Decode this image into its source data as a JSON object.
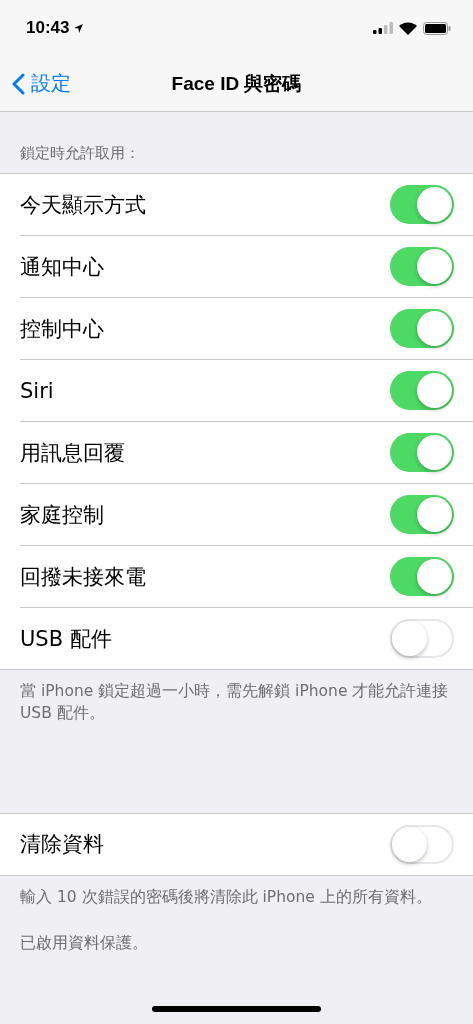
{
  "status_bar": {
    "time": "10:43"
  },
  "nav_bar": {
    "back": "設定",
    "title": "Face ID 與密碼"
  },
  "groups": [
    {
      "header": "鎖定時允許取用：",
      "rows": [
        {
          "label": "今天顯示方式",
          "on": true
        },
        {
          "label": "通知中心",
          "on": true
        },
        {
          "label": "控制中心",
          "on": true
        },
        {
          "label": "Siri",
          "on": true
        },
        {
          "label": "用訊息回覆",
          "on": true
        },
        {
          "label": "家庭控制",
          "on": true
        },
        {
          "label": "回撥未接來電",
          "on": true
        },
        {
          "label": "USB 配件",
          "on": false
        }
      ],
      "footers": [
        "當 iPhone 鎖定超過一小時，需先解鎖 iPhone 才能允許連接 USB 配件。"
      ]
    },
    {
      "rows": [
        {
          "label": "清除資料",
          "on": false
        }
      ],
      "footers": [
        "輸入 10 次錯誤的密碼後將清除此 iPhone 上的所有資料。",
        "已啟用資料保護。"
      ]
    }
  ]
}
